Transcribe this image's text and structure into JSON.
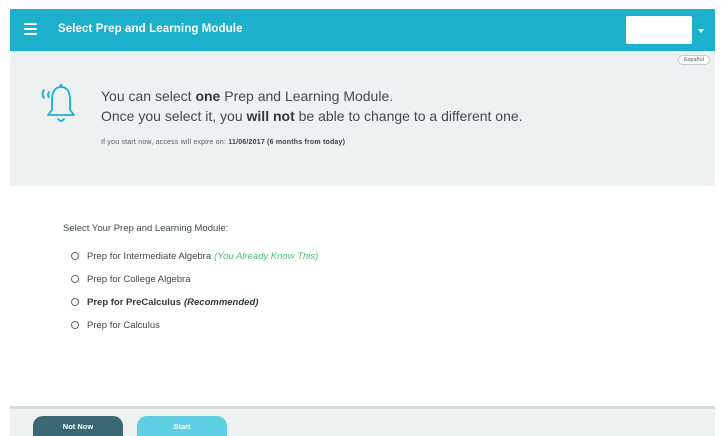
{
  "header": {
    "title": "Select Prep and Learning Module"
  },
  "notice": {
    "language_button": "Español",
    "line1_prefix": "You can select ",
    "line1_bold": "one",
    "line1_suffix": " Prep and Learning Module.",
    "line2_prefix": "Once you select it, you ",
    "line2_bold": "will not",
    "line2_suffix": " be able to change to a different one.",
    "expire_prefix": "If you start now, access will expire on: ",
    "expire_bold": "11/06/2017 (6 months from today)"
  },
  "modules": {
    "heading": "Select Your Prep and Learning Module:",
    "options": [
      {
        "label": "Prep for Intermediate Algebra",
        "note": "(You Already Know This)"
      },
      {
        "label": "Prep for College Algebra"
      },
      {
        "label": "Prep for PreCalculus",
        "note": "(Recommended)"
      },
      {
        "label": "Prep for Calculus"
      }
    ]
  },
  "footer": {
    "not_now_label": "Not Now",
    "start_label": "Start"
  },
  "colors": {
    "header_bg": "#1cb0cc",
    "note_green": "#4cc56b",
    "not_now_bg": "#3a6874",
    "start_bg": "#5fd0e3"
  },
  "icons": [
    "menu-icon",
    "bell-icon",
    "chevron-down-icon"
  ]
}
